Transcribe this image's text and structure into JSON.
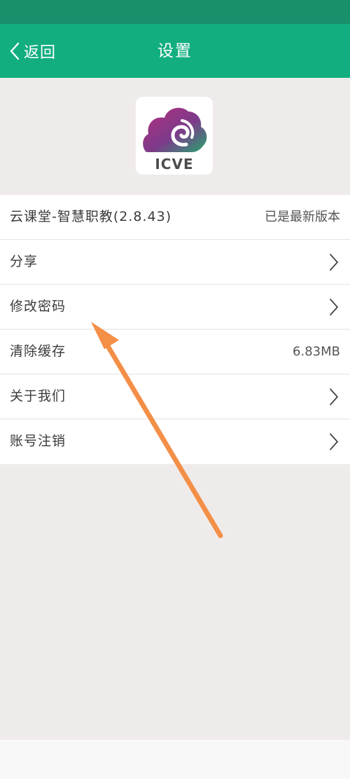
{
  "header": {
    "back_label": "返回",
    "title": "设置"
  },
  "logo": {
    "text": "ICVE"
  },
  "version_row": {
    "label": "云课堂-智慧职教(2.8.43)",
    "value": "已是最新版本"
  },
  "menu": {
    "share": "分享",
    "change_password": "修改密码",
    "clear_cache": "清除缓存",
    "cache_size": "6.83MB",
    "about_us": "关于我们",
    "account_cancel": "账号注销"
  },
  "colors": {
    "status_bar": "#1a8f6c",
    "header": "#12ae80",
    "page_background": "#efebea",
    "annotation_arrow": "#f38f47"
  },
  "icons": {
    "back": "chevron-left-icon",
    "row_arrow": "chevron-right-icon"
  }
}
